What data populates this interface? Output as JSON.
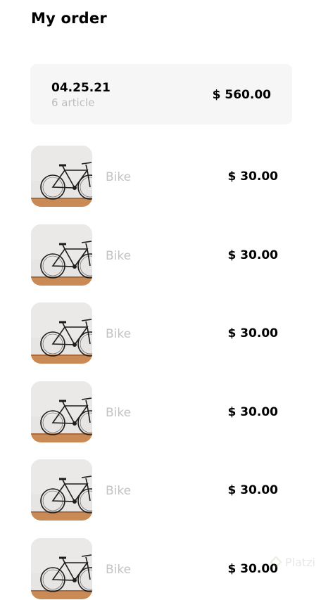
{
  "header": {
    "title": "My order"
  },
  "order": {
    "date": "04.25.21",
    "articles": "6 article",
    "total": "$ 560.00"
  },
  "items": [
    {
      "name": "Bike",
      "price": "$ 30.00",
      "image": "bike-photo"
    },
    {
      "name": "Bike",
      "price": "$ 30.00",
      "image": "bike-photo"
    },
    {
      "name": "Bike",
      "price": "$ 30.00",
      "image": "bike-photo"
    },
    {
      "name": "Bike",
      "price": "$ 30.00",
      "image": "bike-photo"
    },
    {
      "name": "Bike",
      "price": "$ 30.00",
      "image": "bike-photo"
    },
    {
      "name": "Bike",
      "price": "$ 30.00",
      "image": "bike-photo"
    }
  ],
  "watermark": {
    "text": "Platzi"
  }
}
